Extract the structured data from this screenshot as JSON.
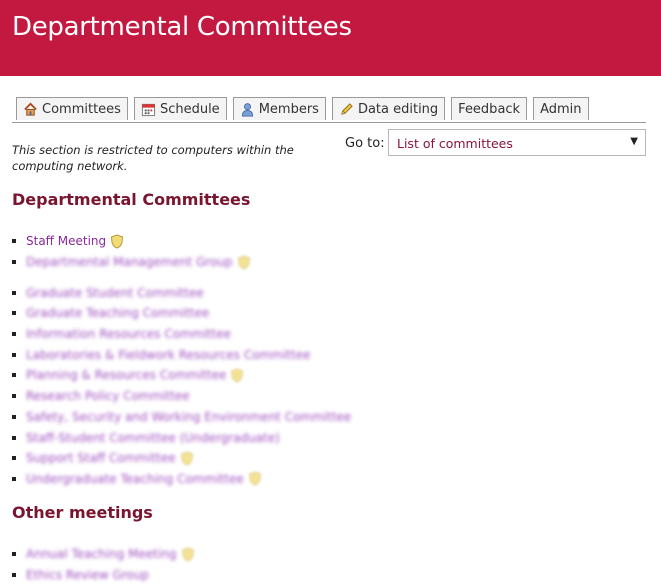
{
  "header": {
    "title": "Departmental Committees"
  },
  "tabs": [
    {
      "label": "Committees",
      "icon": "house-icon"
    },
    {
      "label": "Schedule",
      "icon": "calendar-icon"
    },
    {
      "label": "Members",
      "icon": "person-icon"
    },
    {
      "label": "Data editing",
      "icon": "pencil-icon"
    },
    {
      "label": "Feedback",
      "icon": ""
    },
    {
      "label": "Admin",
      "icon": ""
    }
  ],
  "notice": "This section is restricted to computers within the computing network.",
  "goto": {
    "label": "Go to:",
    "selected": "List of committees"
  },
  "sections": [
    {
      "heading": "Departmental Committees",
      "groups": [
        [
          {
            "label": "Staff Meeting",
            "shield": true,
            "blurred": false
          },
          {
            "label": "Departmental Management Group",
            "shield": true,
            "blurred": true
          }
        ],
        [
          {
            "label": "Graduate Student Committee",
            "shield": false,
            "blurred": true
          },
          {
            "label": "Graduate Teaching Committee",
            "shield": false,
            "blurred": true
          },
          {
            "label": "Information Resources Committee",
            "shield": false,
            "blurred": true
          },
          {
            "label": "Laboratories & Fieldwork Resources Committee",
            "shield": false,
            "blurred": true
          },
          {
            "label": "Planning & Resources Committee",
            "shield": true,
            "blurred": true
          },
          {
            "label": "Research Policy Committee",
            "shield": false,
            "blurred": true
          },
          {
            "label": "Safety, Security and Working Environment Committee",
            "shield": false,
            "blurred": true
          },
          {
            "label": "Staff-Student Committee (Undergraduate)",
            "shield": false,
            "blurred": true
          },
          {
            "label": "Support Staff Committee",
            "shield": true,
            "blurred": true
          },
          {
            "label": "Undergraduate Teaching Committee",
            "shield": true,
            "blurred": true
          }
        ]
      ]
    },
    {
      "heading": "Other meetings",
      "groups": [
        [
          {
            "label": "Annual Teaching Meeting",
            "shield": true,
            "blurred": true
          },
          {
            "label": "Ethics Review Group",
            "shield": false,
            "blurred": true
          }
        ]
      ]
    }
  ],
  "colors": {
    "banner": "#c3183f",
    "heading": "#7a1530",
    "link": "#8a2a9a"
  }
}
